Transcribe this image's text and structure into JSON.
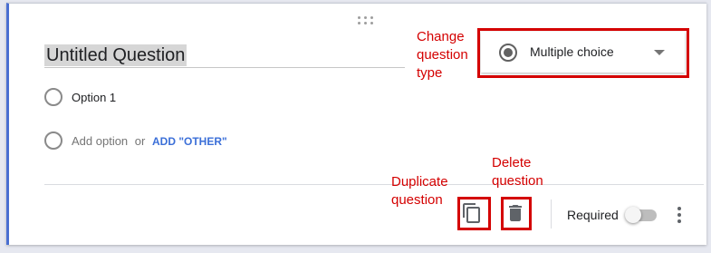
{
  "question": {
    "title": "Untitled Question",
    "options": [
      {
        "label": "Option 1"
      }
    ],
    "add_option_label": "Add option",
    "or_label": "or",
    "add_other_label": "ADD \"OTHER\""
  },
  "question_type": {
    "selected": "Multiple choice",
    "icon": "radio-button-checked-icon"
  },
  "footer": {
    "duplicate_icon": "content-copy-icon",
    "delete_icon": "trash-icon",
    "required_label": "Required",
    "required_on": false,
    "more_icon": "more-vert-icon"
  },
  "annotations": {
    "change_type": "Change\nquestion\ntype",
    "duplicate": "Duplicate\nquestion",
    "delete": "Delete\nquestion",
    "color": "#d40000"
  },
  "colors": {
    "accent": "#4a6fd1",
    "link": "#3b6fd8",
    "annotation": "#d40000"
  }
}
